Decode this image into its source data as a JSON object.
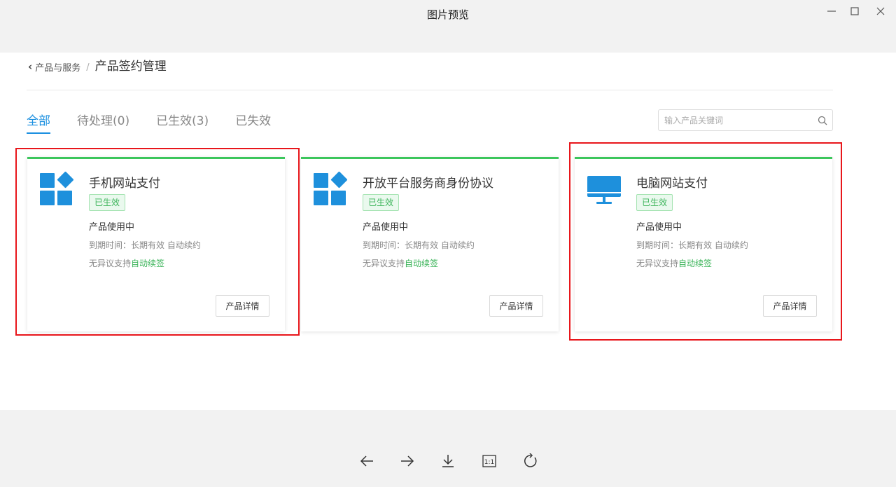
{
  "window": {
    "title": "图片预览",
    "controls": {
      "minimize": "minimize-icon",
      "maximize": "maximize-icon",
      "close": "close-icon"
    }
  },
  "breadcrumb": {
    "back_label": "产品与服务",
    "separator": "/",
    "current": "产品签约管理"
  },
  "tabs": [
    {
      "label": "全部",
      "active": true
    },
    {
      "label": "待处理(0)",
      "active": false
    },
    {
      "label": "已生效(3)",
      "active": false
    },
    {
      "label": "已失效",
      "active": false
    }
  ],
  "search": {
    "placeholder": "输入产品关键词",
    "icon": "search-icon"
  },
  "cards": [
    {
      "title": "手机网站支付",
      "icon": "app-grid-icon",
      "status": "已生效",
      "usage": "产品使用中",
      "expire": "到期时间：长期有效 自动续约",
      "renew_prefix": "无异议支持",
      "renew_link": "自动续签",
      "button": "产品详情"
    },
    {
      "title": "开放平台服务商身份协议",
      "icon": "app-grid-icon",
      "status": "已生效",
      "usage": "产品使用中",
      "expire": "到期时间：长期有效 自动续约",
      "renew_prefix": "无异议支持",
      "renew_link": "自动续签",
      "button": "产品详情"
    },
    {
      "title": "电脑网站支付",
      "icon": "monitor-icon",
      "status": "已生效",
      "usage": "产品使用中",
      "expire": "到期时间：长期有效 自动续约",
      "renew_prefix": "无异议支持",
      "renew_link": "自动续签",
      "button": "产品详情"
    }
  ],
  "colors": {
    "accent": "#1a8fe0",
    "success": "#3cc65c",
    "highlight": "#e8161b",
    "icon": "#1e90dc"
  },
  "viewer_toolbar": {
    "items": [
      "arrow-left-icon",
      "arrow-right-icon",
      "download-icon",
      "actual-size-icon",
      "rotate-icon"
    ],
    "actual_size_label": "1:1"
  }
}
